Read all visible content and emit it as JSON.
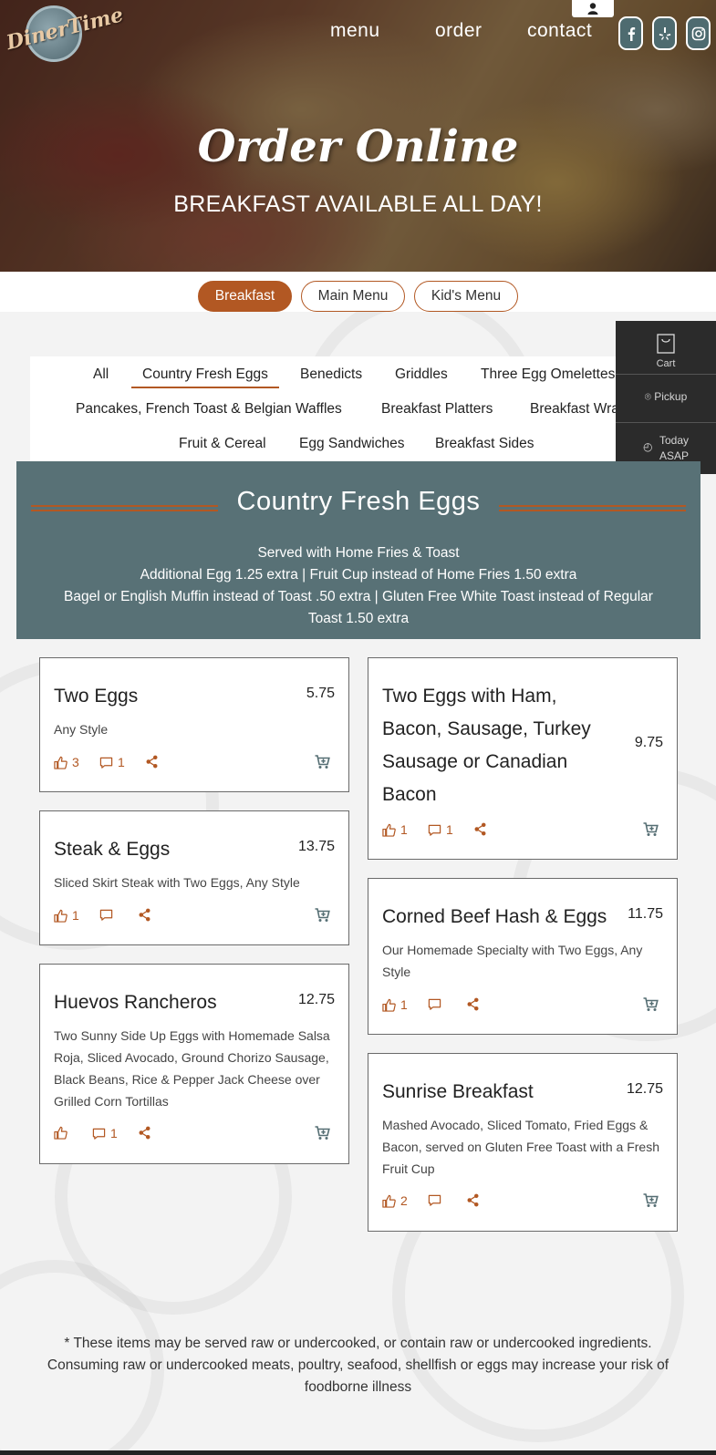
{
  "brand": {
    "logo_text": "DinerTime"
  },
  "nav": {
    "menu": "menu",
    "order": "order",
    "contact": "contact"
  },
  "social": [
    "facebook-icon",
    "yelp-icon",
    "instagram-icon"
  ],
  "hero": {
    "title": "Order Online",
    "subtitle": "BREAKFAST AVAILABLE ALL DAY!"
  },
  "menu_types": [
    {
      "label": "Breakfast",
      "active": true
    },
    {
      "label": "Main Menu",
      "active": false
    },
    {
      "label": "Kid's Menu",
      "active": false
    }
  ],
  "categories": [
    "All",
    "Country Fresh Eggs",
    "Benedicts",
    "Griddles",
    "Three Egg Omelettes",
    "Pancakes, French Toast & Belgian Waffles",
    "Breakfast Platters",
    "Breakfast Wraps",
    "Fruit & Cereal",
    "Egg Sandwiches",
    "Breakfast Sides"
  ],
  "cart_panel": {
    "cart": "Cart",
    "pickup": "Pickup",
    "time_line1": "Today",
    "time_line2": "ASAP"
  },
  "section": {
    "title": "Country Fresh Eggs",
    "desc_lines": [
      "Served with Home Fries & Toast",
      "Additional Egg 1.25 extra | Fruit Cup instead of Home Fries 1.50 extra",
      "Bagel or English Muffin instead of Toast .50 extra | Gluten Free White Toast instead of Regular",
      "Toast 1.50 extra"
    ]
  },
  "items": [
    {
      "name": "Two Eggs",
      "price": "5.75",
      "desc": "Any Style",
      "likes": "3",
      "comments": "1"
    },
    {
      "name": "Two Eggs with Ham, Bacon, Sausage, Turkey Sausage or Canadian Bacon",
      "price": "9.75",
      "desc": "",
      "likes": "1",
      "comments": "1"
    },
    {
      "name": "Steak & Eggs",
      "price": "13.75",
      "desc": "Sliced Skirt Steak with Two Eggs, Any Style",
      "likes": "1",
      "comments": ""
    },
    {
      "name": "Corned Beef Hash & Eggs",
      "price": "11.75",
      "desc": "Our Homemade Specialty with Two Eggs, Any Style",
      "likes": "1",
      "comments": ""
    },
    {
      "name": "Huevos Rancheros",
      "price": "12.75",
      "desc": "Two Sunny Side Up Eggs with Homemade Salsa Roja, Sliced Avocado, Ground Chorizo Sausage, Black Beans, Rice & Pepper Jack Cheese over Grilled Corn Tortillas",
      "likes": "",
      "comments": "1"
    },
    {
      "name": "Sunrise Breakfast",
      "price": "12.75",
      "desc": "Mashed Avocado, Sliced Tomato, Fried Eggs & Bacon, served on Gluten Free Toast with a Fresh Fruit Cup",
      "likes": "2",
      "comments": ""
    }
  ],
  "footnote": "* These items may be served raw or undercooked, or contain raw or undercooked ingredients. Consuming raw or undercooked meats, poultry, seafood, shellfish or eggs may increase your risk of foodborne illness",
  "colors": {
    "accent": "#b25823",
    "section_bg": "#587176",
    "cart_bg": "#2b2b2b"
  }
}
